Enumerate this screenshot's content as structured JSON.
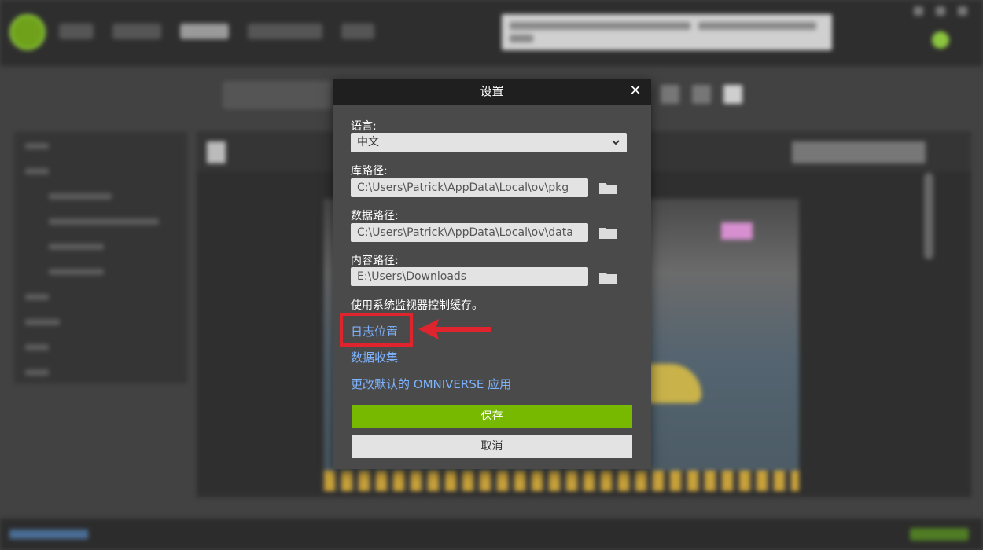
{
  "dialog": {
    "title": "设置",
    "close": "✕",
    "language_label": "语言:",
    "language_value": "中文",
    "library_path_label": "库路径:",
    "library_path_value": "C:\\Users\\Patrick\\AppData\\Local\\ov\\pkg",
    "data_path_label": "数据路径:",
    "data_path_value": "C:\\Users\\Patrick\\AppData\\Local\\ov\\data",
    "content_path_label": "内容路径:",
    "content_path_value": "E:\\Users\\Downloads",
    "cache_text": "使用系统监视器控制缓存。",
    "log_location_link": "日志位置",
    "data_collection_link": "数据收集",
    "change_default_app_link": "更改默认的 OMNIVERSE 应用",
    "save_label": "保存",
    "cancel_label": "取消"
  },
  "colors": {
    "accent_green": "#76b900",
    "link_blue": "#7db3ff",
    "highlight_red": "#e0242e",
    "header_dark": "#1f1f1f"
  },
  "icons": [
    "close-icon",
    "chevron-down-icon",
    "folder-icon",
    "red-arrow-icon"
  ]
}
